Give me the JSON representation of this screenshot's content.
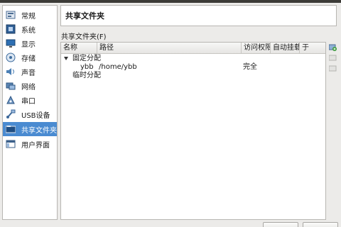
{
  "sidebar": {
    "items": [
      {
        "label": "常规",
        "icon": "general-icon"
      },
      {
        "label": "系统",
        "icon": "system-icon"
      },
      {
        "label": "显示",
        "icon": "display-icon"
      },
      {
        "label": "存储",
        "icon": "storage-icon"
      },
      {
        "label": "声音",
        "icon": "audio-icon"
      },
      {
        "label": "网络",
        "icon": "network-icon"
      },
      {
        "label": "串口",
        "icon": "serial-port-icon"
      },
      {
        "label": "USB设备",
        "icon": "usb-icon"
      },
      {
        "label": "共享文件夹",
        "icon": "shared-folder-icon",
        "selected": true
      },
      {
        "label": "用户界面",
        "icon": "user-interface-icon"
      }
    ]
  },
  "header": {
    "title": "共享文件夹"
  },
  "section": {
    "label": "共享文件夹(F)"
  },
  "table": {
    "columns": [
      "名称",
      "路径",
      "访问权限",
      "自动挂载",
      "于"
    ],
    "groups": [
      {
        "label": "固定分配",
        "expanded": true,
        "rows": [
          {
            "name": "ybb",
            "path": "/home/ybb",
            "access": "完全",
            "automount": "",
            "at": ""
          }
        ]
      },
      {
        "label": "临时分配",
        "expanded": false,
        "rows": []
      }
    ]
  },
  "colors": {
    "selection": "#4a8bd1",
    "add_icon": "#3b9a3b"
  }
}
